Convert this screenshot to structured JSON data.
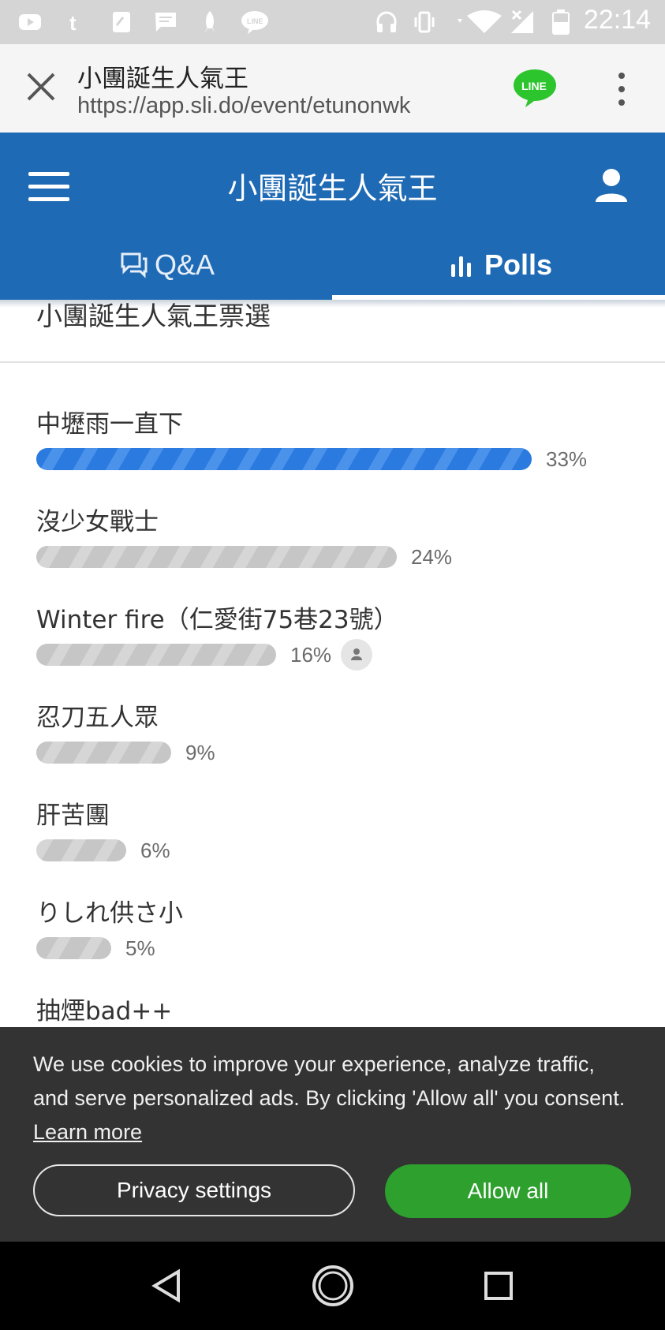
{
  "status_bar": {
    "time": "22:14",
    "icons": [
      "youtube-icon",
      "tumblr-icon",
      "doc-icon",
      "message-icon",
      "rocket-icon",
      "line-icon",
      "headset-icon",
      "vibrate-icon",
      "wifi-icon",
      "signal-icon",
      "battery-icon"
    ]
  },
  "browser": {
    "title": "小團誕生人氣王",
    "url": "https://app.sli.do/event/etunonwk",
    "line_badge": "LINE"
  },
  "app": {
    "title": "小團誕生人氣王",
    "tabs": [
      {
        "label": "Q&A",
        "active": false
      },
      {
        "label": "Polls",
        "active": true
      }
    ],
    "accent_color": "#1f6ab5"
  },
  "poll": {
    "title": "小團誕生人氣王票選",
    "options": [
      {
        "label": "中壢雨一直下",
        "percent": 33,
        "percent_text": "33%",
        "leading": true
      },
      {
        "label": "沒少女戰士",
        "percent": 24,
        "percent_text": "24%"
      },
      {
        "label": "Winter fire（仁愛街75巷23號）",
        "percent": 16,
        "percent_text": "16%",
        "my_vote": true
      },
      {
        "label": "忍刀五人眾",
        "percent": 9,
        "percent_text": "9%"
      },
      {
        "label": "肝苦團",
        "percent": 6,
        "percent_text": "6%"
      },
      {
        "label": "りしれ供さ小",
        "percent": 5,
        "percent_text": "5%"
      },
      {
        "label": "抽煙bad++"
      }
    ]
  },
  "cookie_banner": {
    "text": "We use cookies to improve your experience, analyze traffic, and serve personalized ads. By clicking 'Allow all' you consent.",
    "learn_more": "Learn more",
    "privacy_button": "Privacy settings",
    "allow_button": "Allow all",
    "allow_color": "#2da02d"
  },
  "nav_bar": {
    "buttons": [
      "back-icon",
      "home-icon",
      "recents-icon"
    ]
  }
}
